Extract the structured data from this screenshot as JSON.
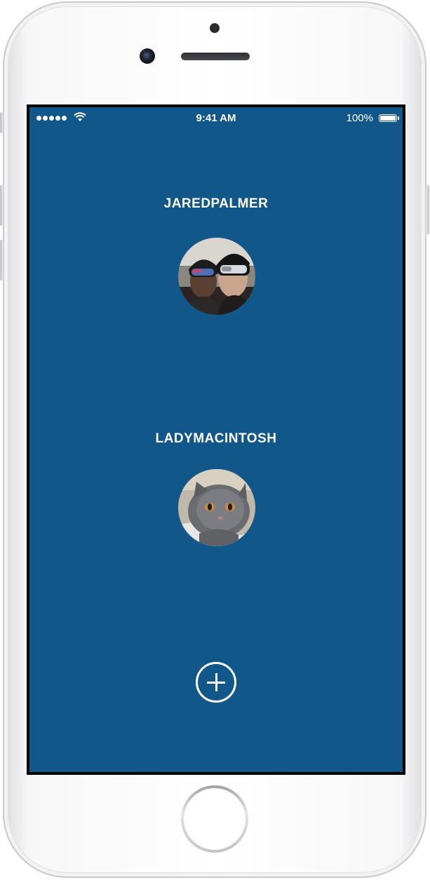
{
  "status_bar": {
    "time": "9:41 AM",
    "battery_percent": "100%",
    "signal_dots": 5,
    "icons": [
      "signal-dots-icon",
      "wifi-icon",
      "battery-icon"
    ]
  },
  "accounts": [
    {
      "username": "JAREDPALMER",
      "avatar_icon": "avatar-photo-two-people-ski-goggles"
    },
    {
      "username": "LADYMACINTOSH",
      "avatar_icon": "avatar-photo-grey-cat"
    }
  ],
  "add_account": {
    "icon": "plus-circle-icon"
  },
  "colors": {
    "screen_background": "#12578a",
    "text": "#ffffff",
    "phone_body": "#ffffff"
  }
}
